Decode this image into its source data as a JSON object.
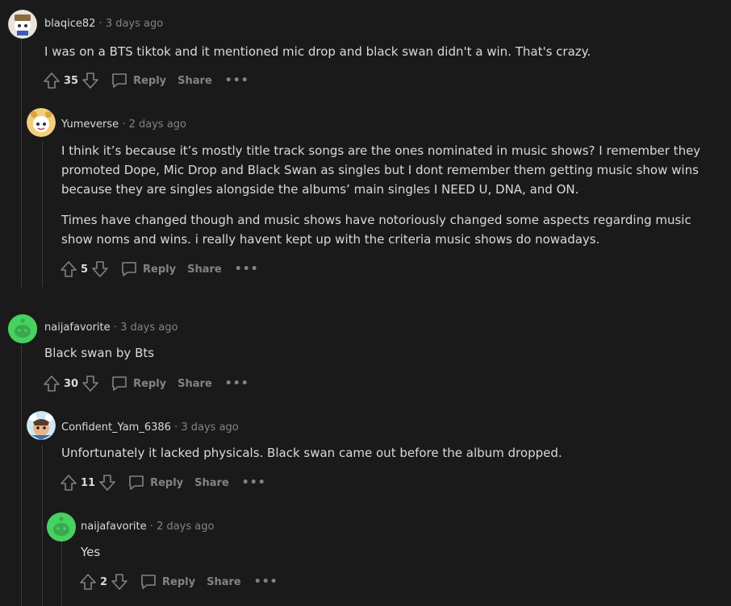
{
  "comments": [
    {
      "user": "blaqice82",
      "time": "3 days ago",
      "body": [
        "I was on a BTS tiktok and it mentioned mic drop and black swan didn't a win. That's crazy."
      ],
      "votes": "35",
      "reply": "Reply",
      "share": "Share",
      "more": "•••"
    },
    {
      "user": "Yumeverse",
      "time": "2 days ago",
      "body": [
        "I think it’s because it’s mostly title track songs are the ones nominated in music shows? I remember they promoted Dope, Mic Drop and Black Swan as singles but I dont remember them getting music show wins because they are singles alongside the albums’ main singles I NEED U, DNA, and ON.",
        "Times have changed though and music shows have notoriously changed some aspects regarding music show noms and wins. i really havent kept up with the criteria music shows do nowadays."
      ],
      "votes": "5",
      "reply": "Reply",
      "share": "Share",
      "more": "•••"
    },
    {
      "user": "naijafavorite",
      "time": "3 days ago",
      "body": [
        "Black swan by Bts"
      ],
      "votes": "30",
      "reply": "Reply",
      "share": "Share",
      "more": "•••"
    },
    {
      "user": "Confident_Yam_6386",
      "time": "3 days ago",
      "body": [
        "Unfortunately it lacked physicals. Black swan came out before the album dropped."
      ],
      "votes": "11",
      "reply": "Reply",
      "share": "Share",
      "more": "•••"
    },
    {
      "user": "naijafavorite",
      "time": "2 days ago",
      "body": [
        "Yes"
      ],
      "votes": "2",
      "reply": "Reply",
      "share": "Share",
      "more": "•••"
    }
  ],
  "meta_separator": "·",
  "colors": {
    "background": "#1a1a1b",
    "text": "#d7dadc",
    "muted": "#818384",
    "thread_line": "#3a3b3c",
    "avatar_green": "#46d160"
  }
}
